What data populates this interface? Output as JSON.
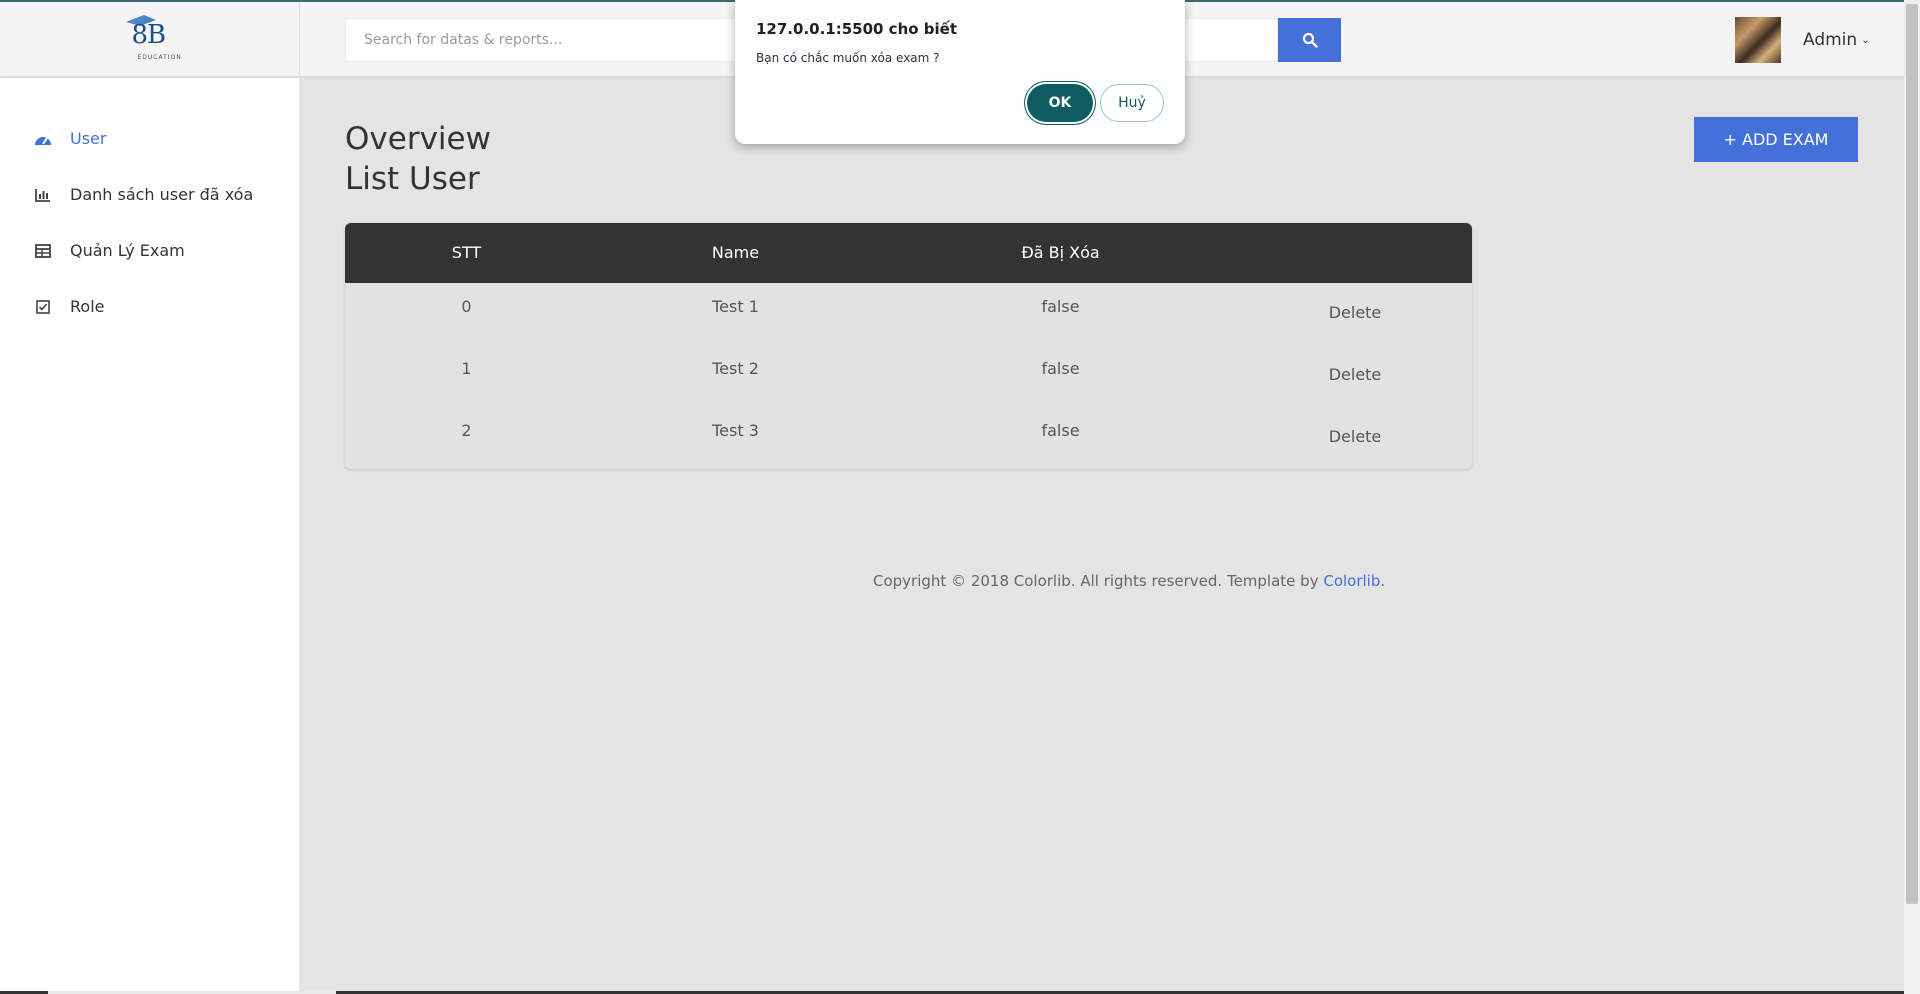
{
  "header": {
    "logo_text": "8B",
    "logo_sub": "EDUCATION",
    "search_placeholder": "Search for datas & reports...",
    "user_name": "Admin"
  },
  "sidebar": {
    "items": [
      {
        "label": "User",
        "icon": "dashboard-icon",
        "active": true
      },
      {
        "label": "Danh sách user đã xóa",
        "icon": "bar-chart-icon",
        "active": false
      },
      {
        "label": "Quản Lý Exam",
        "icon": "table-icon",
        "active": false
      },
      {
        "label": "Role",
        "icon": "checkbox-icon",
        "active": false
      }
    ]
  },
  "main": {
    "title": "Overview",
    "subtitle": "List User",
    "add_button": "+ ADD EXAM",
    "table": {
      "headers": [
        "STT",
        "Name",
        "Đã Bị Xóa",
        ""
      ],
      "rows": [
        {
          "stt": "0",
          "name": "Test 1",
          "deleted": "false",
          "action": "Delete"
        },
        {
          "stt": "1",
          "name": "Test 2",
          "deleted": "false",
          "action": "Delete"
        },
        {
          "stt": "2",
          "name": "Test 3",
          "deleted": "false",
          "action": "Delete"
        }
      ]
    },
    "footer": {
      "text": "Copyright © 2018 Colorlib. All rights reserved. Template by ",
      "link": "Colorlib."
    }
  },
  "dialog": {
    "title": "127.0.0.1:5500 cho biết",
    "message": "Bạn có chắc muốn xóa exam ?",
    "ok_label": "OK",
    "cancel_label": "Huỷ"
  },
  "colors": {
    "accent": "#4470d9",
    "table_header": "#333333",
    "dialog_ok": "#0f5d63"
  }
}
